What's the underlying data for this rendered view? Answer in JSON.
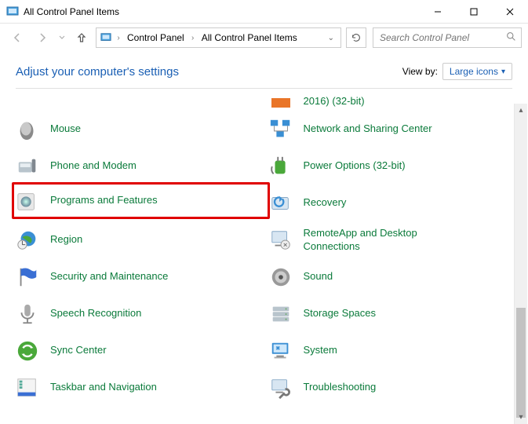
{
  "window": {
    "title": "All Control Panel Items"
  },
  "nav": {
    "breadcrumb": {
      "seg1": "Control Panel",
      "seg2": "All Control Panel Items"
    },
    "search_placeholder": "Search Control Panel"
  },
  "header": {
    "page_title": "Adjust your computer's settings",
    "viewby_label": "View by:",
    "viewby_value": "Large icons"
  },
  "items": {
    "partial_top_right": "2016) (32-bit)",
    "left": [
      "Mouse",
      "Phone and Modem",
      "Programs and Features",
      "Region",
      "Security and Maintenance",
      "Speech Recognition",
      "Sync Center",
      "Taskbar and Navigation"
    ],
    "right": [
      "Network and Sharing Center",
      "Power Options (32-bit)",
      "Recovery",
      "RemoteApp and Desktop Connections",
      "Sound",
      "Storage Spaces",
      "System",
      "Troubleshooting"
    ]
  },
  "highlighted_item": "Programs and Features"
}
